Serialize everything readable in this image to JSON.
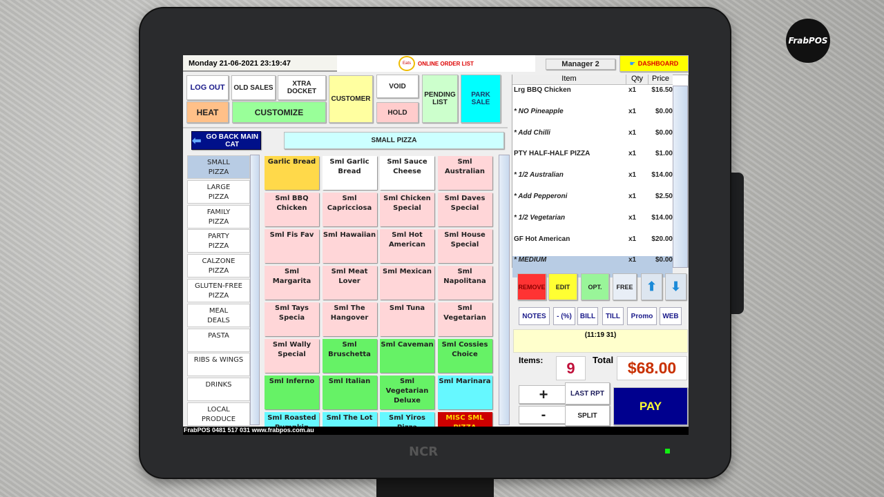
{
  "brand": "FrabPOS",
  "device": "NCR",
  "header": {
    "datetime": "Monday 21-06-2021 23:19:47",
    "online_order": "ONLINE ORDER LIST",
    "user": "Manager 2",
    "dashboard": "DASHBOARD"
  },
  "toolbar": {
    "logout": "LOG OUT",
    "old_sales": "OLD SALES",
    "xtra_docket": "XTRA DOCKET",
    "customer": "CUSTOMER",
    "void": "VOID",
    "pending": "PENDING LIST",
    "park": "PARK SALE",
    "heat": "HEAT",
    "customize": "CUSTOMIZE",
    "hold": "HOLD"
  },
  "nav": {
    "back": "GO BACK MAIN CAT",
    "current": "SMALL PIZZA"
  },
  "categories": [
    {
      "l1": "SMALL",
      "l2": "PIZZA"
    },
    {
      "l1": "LARGE",
      "l2": "PIZZA"
    },
    {
      "l1": "FAMILY",
      "l2": "PIZZA"
    },
    {
      "l1": "PARTY",
      "l2": "PIZZA"
    },
    {
      "l1": "CALZONE",
      "l2": "PIZZA"
    },
    {
      "l1": "GLUTEN-FREE",
      "l2": "PIZZA"
    },
    {
      "l1": "MEAL",
      "l2": "DEALS"
    },
    {
      "l1": "PASTA",
      "l2": ""
    },
    {
      "l1": "RIBS & WINGS",
      "l2": ""
    },
    {
      "l1": "DRINKS",
      "l2": ""
    },
    {
      "l1": "LOCAL",
      "l2": "PRODUCE"
    }
  ],
  "products": [
    {
      "name": "Garlic Bread",
      "color": "#ffd94a"
    },
    {
      "name": "Sml Garlic Bread",
      "color": "#ffffff"
    },
    {
      "name": "Sml Sauce Cheese",
      "color": "#ffffff"
    },
    {
      "name": "Sml Australian",
      "color": "#ffd6d8"
    },
    {
      "name": "Sml BBQ Chicken",
      "color": "#ffd6d8"
    },
    {
      "name": "Sml Capricciosa",
      "color": "#ffd6d8"
    },
    {
      "name": "Sml Chicken Special",
      "color": "#ffd6d8"
    },
    {
      "name": "Sml Daves Special",
      "color": "#ffd6d8"
    },
    {
      "name": "Sml Fis Fav",
      "color": "#ffd6d8"
    },
    {
      "name": "Sml Hawaiian",
      "color": "#ffd6d8"
    },
    {
      "name": "Sml Hot American",
      "color": "#ffd6d8"
    },
    {
      "name": "Sml House Special",
      "color": "#ffd6d8"
    },
    {
      "name": "Sml Margarita",
      "color": "#ffd6d8"
    },
    {
      "name": "Sml Meat Lover",
      "color": "#ffd6d8"
    },
    {
      "name": "Sml Mexican",
      "color": "#ffd6d8"
    },
    {
      "name": "Sml Napolitana",
      "color": "#ffd6d8"
    },
    {
      "name": "Sml Tays Specia",
      "color": "#ffd6d8"
    },
    {
      "name": "Sml The Hangover",
      "color": "#ffd6d8"
    },
    {
      "name": "Sml Tuna",
      "color": "#ffd6d8"
    },
    {
      "name": "Sml Vegetarian",
      "color": "#ffd6d8"
    },
    {
      "name": "Sml Wally Special",
      "color": "#ffd6d8"
    },
    {
      "name": "Sml Bruschetta",
      "color": "#66f266"
    },
    {
      "name": "Sml Caveman",
      "color": "#66f266"
    },
    {
      "name": "Sml Cossies Choice",
      "color": "#66f266"
    },
    {
      "name": "Sml Inferno",
      "color": "#66f266"
    },
    {
      "name": "Sml Italian",
      "color": "#66f266"
    },
    {
      "name": "Sml Vegetarian Deluxe",
      "color": "#66f266"
    },
    {
      "name": "Sml Marinara",
      "color": "#66f8ff"
    },
    {
      "name": "Sml Roasted Pumpkin",
      "color": "#66f8ff"
    },
    {
      "name": "Sml The Lot",
      "color": "#66f8ff"
    },
    {
      "name": "Sml Yiros Pizza",
      "color": "#66f8ff"
    },
    {
      "name": "MISC SML PIZZA",
      "color": "#cc0000"
    }
  ],
  "order": {
    "headers": {
      "item": "Item",
      "qty": "Qty",
      "price": "Price"
    },
    "rows": [
      {
        "item": "Lrg BBQ Chicken",
        "qty": "x1",
        "price": "$16.50",
        "mod": false
      },
      {
        "item": "*   NO Pineapple",
        "qty": "x1",
        "price": "$0.00",
        "mod": true
      },
      {
        "item": "*   Add Chilli",
        "qty": "x1",
        "price": "$0.00",
        "mod": true
      },
      {
        "item": "PTY HALF-HALF PIZZA",
        "qty": "x1",
        "price": "$1.00",
        "mod": false
      },
      {
        "item": "*  1/2 Australian",
        "qty": "x1",
        "price": "$14.00",
        "mod": true
      },
      {
        "item": "*   Add Pepperoni",
        "qty": "x1",
        "price": "$2.50",
        "mod": true
      },
      {
        "item": "*  1/2 Vegetarian",
        "qty": "x1",
        "price": "$14.00",
        "mod": true
      },
      {
        "item": "GF Hot American",
        "qty": "x1",
        "price": "$20.00",
        "mod": false
      },
      {
        "item": "*  MEDIUM",
        "qty": "x1",
        "price": "$0.00",
        "mod": true,
        "selected": true
      }
    ]
  },
  "actions": {
    "remove": "REMOVE",
    "edit": "EDIT",
    "opt": "OPT.",
    "free": "FREE"
  },
  "small_buttons": [
    "NOTES",
    "- (%)",
    "BILL",
    "TILL",
    "Promo",
    "WEB"
  ],
  "note": "(11:19 31)",
  "summary": {
    "items_label": "Items:",
    "items": "9",
    "total_label": "Total",
    "total": "$68.00"
  },
  "bottom": {
    "plus": "+",
    "minus": "-",
    "last_rpt": "LAST RPT",
    "split": "SPLIT",
    "pay": "PAY"
  },
  "footer": "FrabPOS 0481 517 031 www.frabpos.com.au"
}
